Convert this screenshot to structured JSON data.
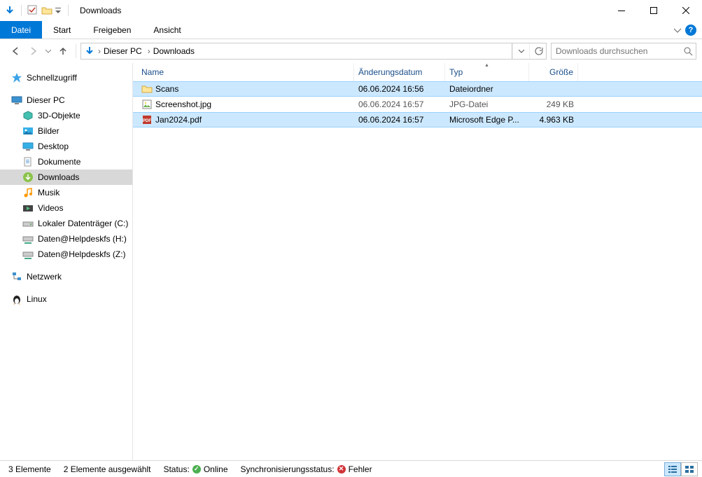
{
  "window": {
    "title": "Downloads"
  },
  "ribbon": {
    "file": "Datei",
    "tabs": [
      "Start",
      "Freigeben",
      "Ansicht"
    ]
  },
  "breadcrumb": {
    "root": "Dieser PC",
    "current": "Downloads"
  },
  "search": {
    "placeholder": "Downloads durchsuchen"
  },
  "navpane": {
    "quick_access": "Schnellzugriff",
    "this_pc": "Dieser PC",
    "pc_children": [
      {
        "label": "3D-Objekte",
        "icon": "cube"
      },
      {
        "label": "Bilder",
        "icon": "pictures"
      },
      {
        "label": "Desktop",
        "icon": "desktop"
      },
      {
        "label": "Dokumente",
        "icon": "docs"
      },
      {
        "label": "Downloads",
        "icon": "downloads",
        "selected": true
      },
      {
        "label": "Musik",
        "icon": "music"
      },
      {
        "label": "Videos",
        "icon": "videos"
      },
      {
        "label": "Lokaler Datenträger (C:)",
        "icon": "drive"
      },
      {
        "label": "Daten@Helpdeskfs (H:)",
        "icon": "netdrive"
      },
      {
        "label": "Daten@Helpdeskfs (Z:)",
        "icon": "netdrive"
      }
    ],
    "network": "Netzwerk",
    "linux": "Linux"
  },
  "columns": {
    "name": "Name",
    "date": "Änderungsdatum",
    "type": "Typ",
    "size": "Größe"
  },
  "files": [
    {
      "icon": "folder",
      "name": "Scans",
      "date": "06.06.2024 16:56",
      "type": "Dateiordner",
      "size": "",
      "selected": true
    },
    {
      "icon": "image",
      "name": "Screenshot.jpg",
      "date": "06.06.2024 16:57",
      "type": "JPG-Datei",
      "size": "249 KB",
      "selected": false
    },
    {
      "icon": "pdf",
      "name": "Jan2024.pdf",
      "date": "06.06.2024 16:57",
      "type": "Microsoft Edge P...",
      "size": "4.963 KB",
      "selected": true
    }
  ],
  "status": {
    "count": "3 Elemente",
    "selected": "2 Elemente ausgewählt",
    "status_label": "Status:",
    "status_value": "Online",
    "sync_label": "Synchronisierungsstatus:",
    "sync_value": "Fehler"
  }
}
